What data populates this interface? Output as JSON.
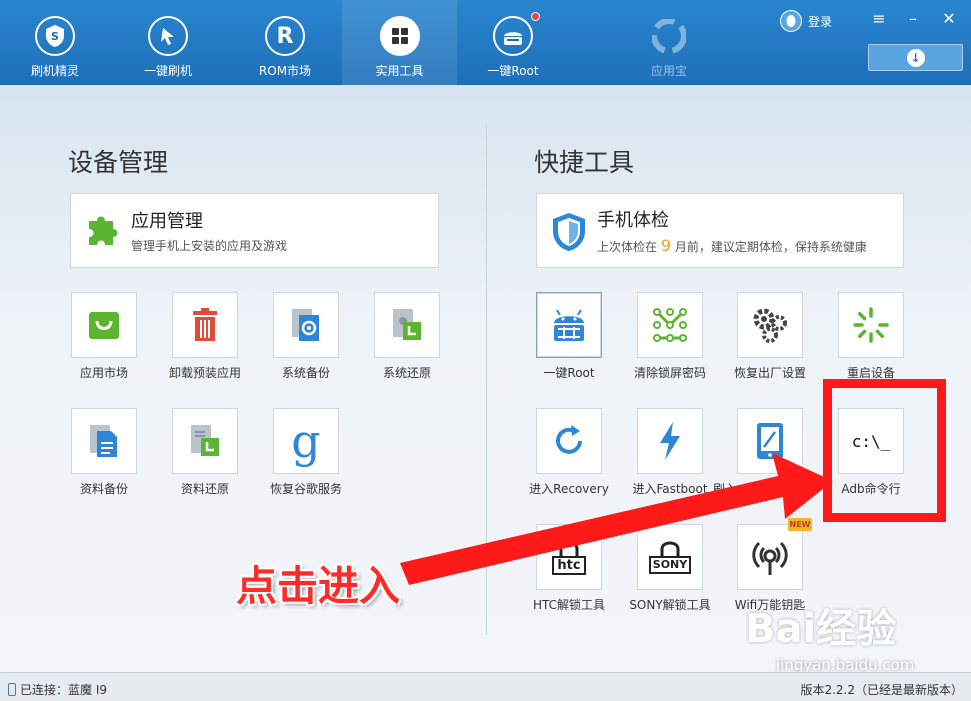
{
  "nav": {
    "items": [
      {
        "label": "刷机精灵",
        "icon": "shield-s-icon"
      },
      {
        "label": "一键刷机",
        "icon": "cursor-icon"
      },
      {
        "label": "ROM市场",
        "icon": "r-icon"
      },
      {
        "label": "实用工具",
        "icon": "grid-icon",
        "active": true
      },
      {
        "label": "一键Root",
        "icon": "android-icon",
        "badge": true
      },
      {
        "label": "应用宝",
        "icon": "yyb-icon",
        "dim": true
      }
    ],
    "login_label": "登录"
  },
  "left": {
    "title": "设备管理",
    "card": {
      "title": "应用管理",
      "subtitle": "管理手机上安装的应用及游戏",
      "icon": "puzzle-icon"
    },
    "tiles": [
      {
        "label": "应用市场",
        "icon": "bag-icon"
      },
      {
        "label": "卸载预装应用",
        "icon": "trash-icon"
      },
      {
        "label": "系统备份",
        "icon": "system-backup-icon"
      },
      {
        "label": "系统还原",
        "icon": "system-restore-icon"
      },
      {
        "label": "资料备份",
        "icon": "data-backup-icon"
      },
      {
        "label": "资料还原",
        "icon": "data-restore-icon"
      },
      {
        "label": "恢复谷歌服务",
        "icon": "google-icon"
      }
    ]
  },
  "right": {
    "title": "快捷工具",
    "card": {
      "title": "手机体检",
      "subtitle_pre": "上次体检在",
      "subtitle_num": "9",
      "subtitle_post": "月前，建议定期体检，保持系统健康",
      "icon": "shield-check-icon"
    },
    "tiles": [
      {
        "label": "一键Root",
        "icon": "android-root-icon"
      },
      {
        "label": "清除锁屏密码",
        "icon": "pattern-lock-icon"
      },
      {
        "label": "恢复出厂设置",
        "icon": "gears-icon"
      },
      {
        "label": "重启设备",
        "icon": "restart-spinner-icon"
      },
      {
        "label": "进入Recovery",
        "icon": "recovery-icon"
      },
      {
        "label": "进入Fastboot",
        "icon": "lightning-icon"
      },
      {
        "label": "刷入",
        "icon": "tablet-pen-icon"
      },
      {
        "label": "Adb命令行",
        "icon": "cmd-icon",
        "text": "c:\\_"
      },
      {
        "label": "HTC解锁工具",
        "icon": "htc-unlock-icon",
        "text": "htc"
      },
      {
        "label": "SONY解锁工具",
        "icon": "sony-unlock-icon",
        "text": "SONY"
      },
      {
        "label": "Wifi万能钥匙",
        "icon": "wifi-key-icon",
        "badge": "NEW"
      }
    ]
  },
  "annotation": {
    "text": "点击进入",
    "color": "#ff1a1a"
  },
  "watermark": {
    "brand": "Bai经验",
    "url": "jingyan.baidu.com"
  },
  "status": {
    "left": "已连接：蓝魔 I9",
    "right": "版本2.2.2（已经是最新版本）"
  },
  "colors": {
    "header": "#1d6fb8",
    "accent_orange": "#f39a1e",
    "green": "#5cb531",
    "blue": "#2d86d6",
    "red": "#e24b3b"
  }
}
